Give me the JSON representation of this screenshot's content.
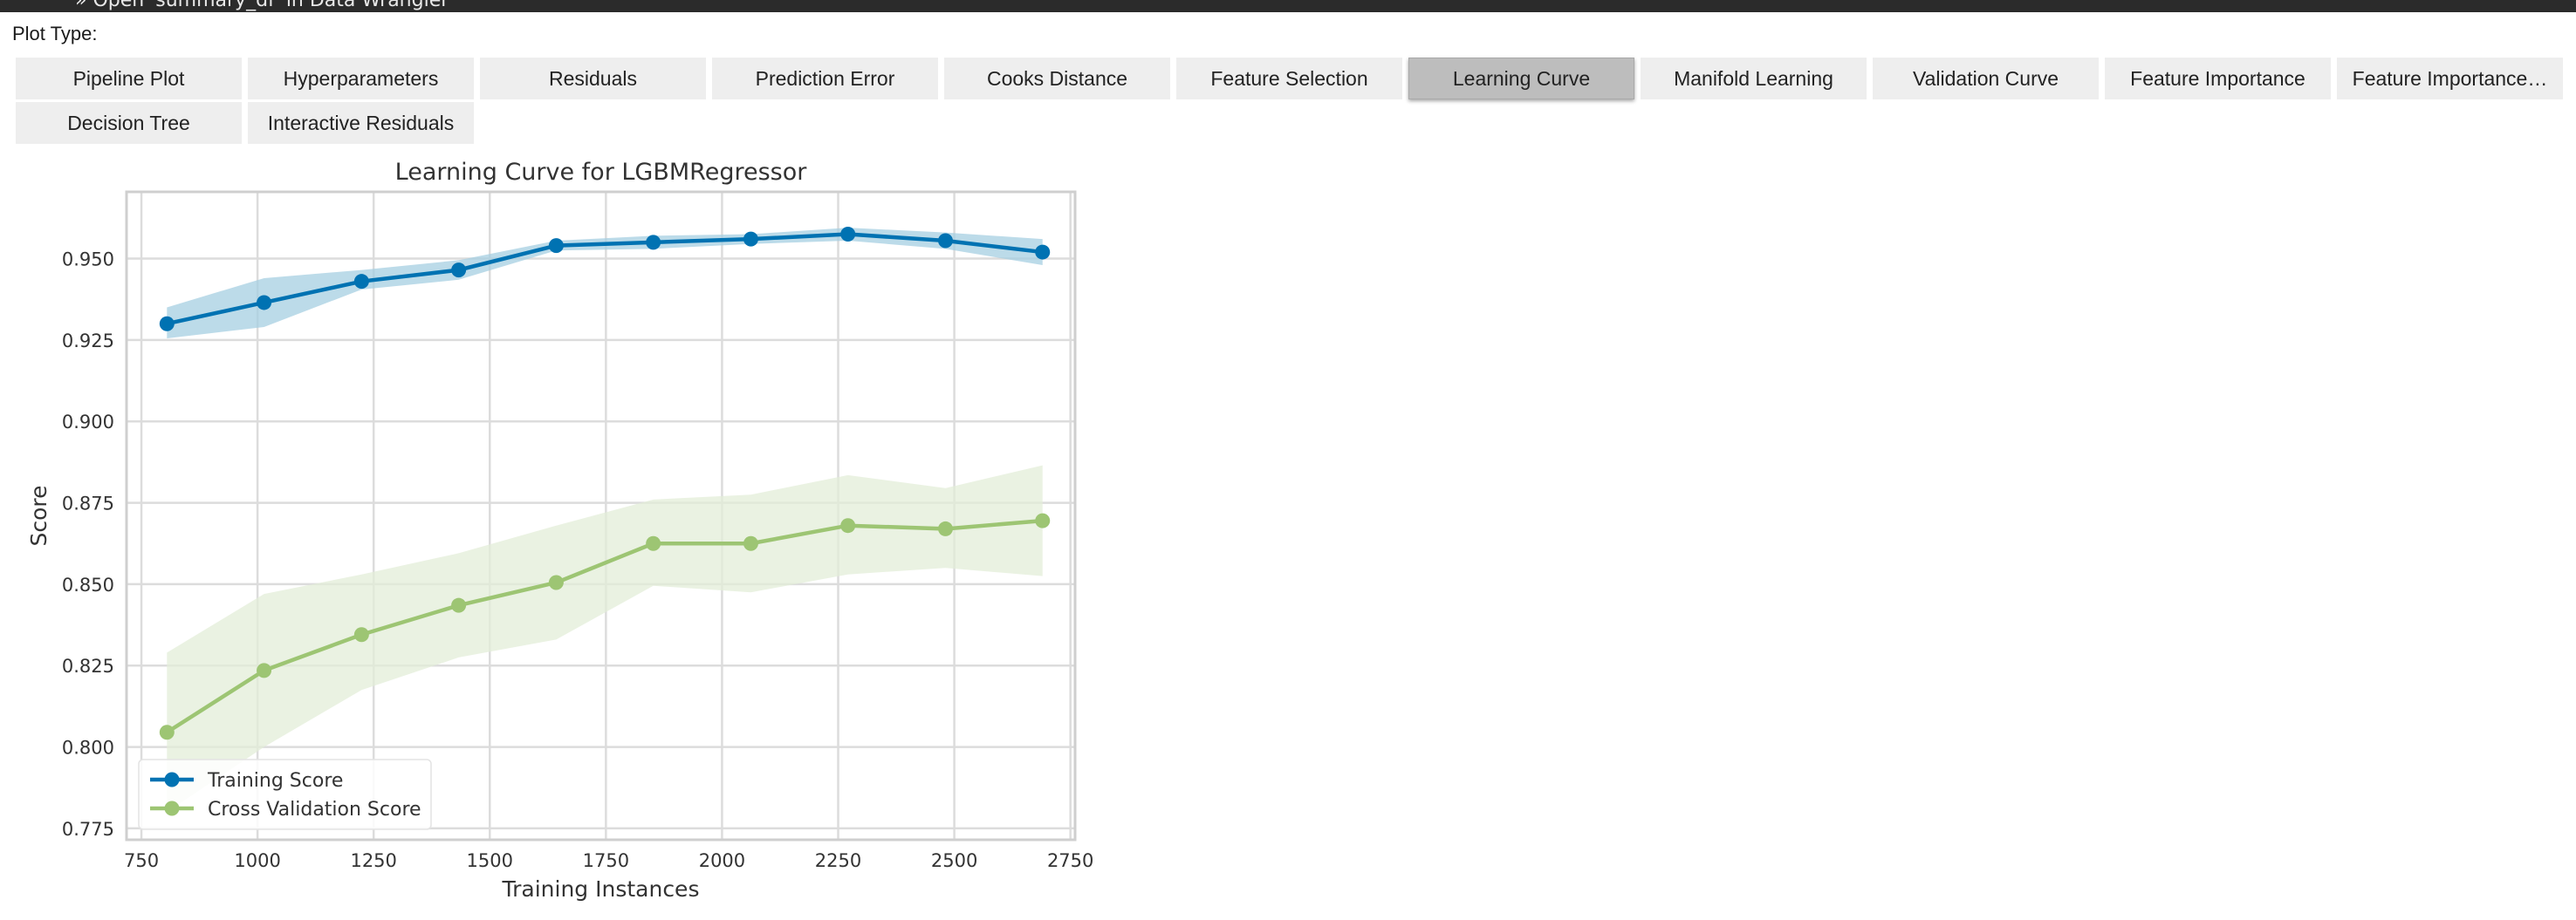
{
  "header": {
    "notice": "» Open 'summary_df' in Data Wrangler"
  },
  "plot_type_label": "Plot Type:",
  "tabs_row1": [
    {
      "label": "Pipeline Plot",
      "name": "tab-pipeline-plot",
      "active": false
    },
    {
      "label": "Hyperparameters",
      "name": "tab-hyperparameters",
      "active": false
    },
    {
      "label": "Residuals",
      "name": "tab-residuals",
      "active": false
    },
    {
      "label": "Prediction Error",
      "name": "tab-prediction-error",
      "active": false
    },
    {
      "label": "Cooks Distance",
      "name": "tab-cooks-distance",
      "active": false
    },
    {
      "label": "Feature Selection",
      "name": "tab-feature-selection",
      "active": false
    },
    {
      "label": "Learning Curve",
      "name": "tab-learning-curve",
      "active": true
    },
    {
      "label": "Manifold Learning",
      "name": "tab-manifold-learning",
      "active": false
    },
    {
      "label": "Validation Curve",
      "name": "tab-validation-curve",
      "active": false
    },
    {
      "label": "Feature Importance",
      "name": "tab-feature-importance",
      "active": false
    },
    {
      "label": "Feature Importance…",
      "name": "tab-feature-importance-all",
      "active": false
    }
  ],
  "tabs_row2": [
    {
      "label": "Decision Tree",
      "name": "tab-decision-tree",
      "active": false
    },
    {
      "label": "Interactive Residuals",
      "name": "tab-interactive-residuals",
      "active": false
    }
  ],
  "chart_data": {
    "type": "line",
    "title": "Learning Curve for LGBMRegressor",
    "xlabel": "Training Instances",
    "ylabel": "Score",
    "xlim": [
      718,
      2760
    ],
    "ylim": [
      0.7715,
      0.9705
    ],
    "xticks": [
      750,
      1000,
      1250,
      1500,
      1750,
      2000,
      2250,
      2500,
      2750
    ],
    "yticks": [
      0.775,
      0.8,
      0.825,
      0.85,
      0.875,
      0.9,
      0.925,
      0.95
    ],
    "ytick_labels": [
      "0.775",
      "0.800",
      "0.825",
      "0.850",
      "0.875",
      "0.900",
      "0.925",
      "0.950"
    ],
    "grid": true,
    "legend_position": "lower-left",
    "x": [
      805,
      1014,
      1224,
      1433,
      1643,
      1852,
      2062,
      2271,
      2481,
      2690
    ],
    "series": [
      {
        "name": "Training Score",
        "color": "#0072b2",
        "band_color": "#a6cfe2",
        "values": [
          0.93,
          0.9365,
          0.943,
          0.9465,
          0.954,
          0.955,
          0.956,
          0.9575,
          0.9555,
          0.952
        ],
        "upper": [
          0.935,
          0.944,
          0.9465,
          0.9495,
          0.9555,
          0.957,
          0.9575,
          0.9595,
          0.958,
          0.956
        ],
        "lower": [
          0.9255,
          0.929,
          0.9405,
          0.9435,
          0.9525,
          0.953,
          0.9545,
          0.9555,
          0.953,
          0.948
        ]
      },
      {
        "name": "Cross Validation Score",
        "color": "#9dc573",
        "band_color": "#e3eed8",
        "values": [
          0.8045,
          0.8235,
          0.8345,
          0.8435,
          0.8505,
          0.8625,
          0.8625,
          0.868,
          0.867,
          0.8695
        ],
        "upper": [
          0.829,
          0.847,
          0.853,
          0.8595,
          0.868,
          0.876,
          0.8775,
          0.8835,
          0.8795,
          0.8865
        ],
        "lower": [
          0.78,
          0.8,
          0.8175,
          0.8275,
          0.833,
          0.8495,
          0.8475,
          0.853,
          0.855,
          0.8525
        ]
      }
    ]
  }
}
